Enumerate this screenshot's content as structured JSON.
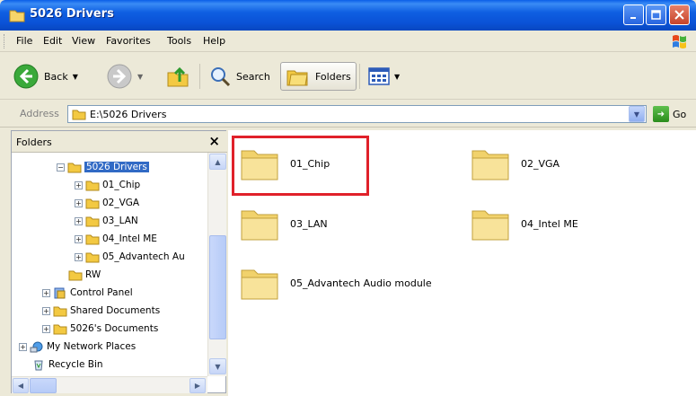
{
  "window": {
    "title": "5026 Drivers",
    "controls": [
      "minimize",
      "maximize",
      "close"
    ]
  },
  "menubar": {
    "items": [
      "File",
      "Edit",
      "View",
      "Favorites",
      "Tools",
      "Help"
    ]
  },
  "toolbar": {
    "back_label": "Back",
    "search_label": "Search",
    "folders_label": "Folders"
  },
  "addressbar": {
    "label": "Address",
    "value": "E:\\5026 Drivers",
    "go_label": "Go"
  },
  "folders_pane": {
    "title": "Folders",
    "close_glyph": "×",
    "tree": [
      {
        "label": "5026 Drivers",
        "expander": "⊟",
        "selected": true
      },
      {
        "label": "01_Chip",
        "expander": "⊞"
      },
      {
        "label": "02_VGA",
        "expander": "⊞"
      },
      {
        "label": "03_LAN",
        "expander": "⊞"
      },
      {
        "label": "04_Intel ME",
        "expander": "⊞"
      },
      {
        "label": "05_Advantech Au",
        "expander": "⊞"
      },
      {
        "label": "RW"
      },
      {
        "label": "Control Panel",
        "expander": "⊞"
      },
      {
        "label": "Shared Documents",
        "expander": "⊞"
      },
      {
        "label": "5026's Documents",
        "expander": "⊞"
      },
      {
        "label": "My Network Places",
        "expander": "⊞"
      },
      {
        "label": "Recycle Bin"
      }
    ]
  },
  "content": {
    "folders": [
      {
        "name": "01_Chip",
        "highlighted": true
      },
      {
        "name": "02_VGA"
      },
      {
        "name": "03_LAN"
      },
      {
        "name": "04_Intel ME"
      },
      {
        "name": "05_Advantech Audio module"
      }
    ],
    "highlight_color": "#e0212a"
  },
  "colors": {
    "titlebar": "#0a52d6",
    "selection": "#316ac5",
    "chrome": "#ece9d8"
  }
}
